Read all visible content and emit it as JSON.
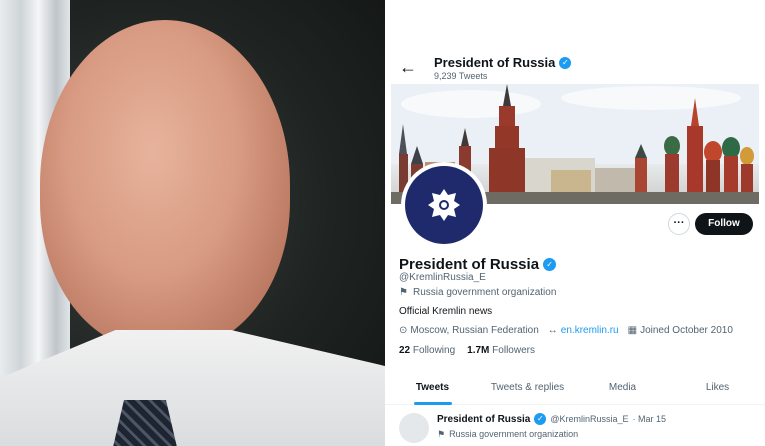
{
  "header": {
    "title": "President of Russia",
    "tweet_count": "9,239 Tweets"
  },
  "profile": {
    "name": "President of Russia",
    "handle": "@KremlinRussia_E",
    "category": "Russia government organization",
    "bio": "Official Kremlin news",
    "location": "Moscow, Russian Federation",
    "website": "en.kremlin.ru",
    "joined": "Joined October 2010",
    "following_count": "22",
    "following_label": "Following",
    "followers_count": "1.7M",
    "followers_label": "Followers"
  },
  "actions": {
    "more": "···",
    "follow": "Follow"
  },
  "tabs": [
    {
      "label": "Tweets",
      "active": true
    },
    {
      "label": "Tweets & replies",
      "active": false
    },
    {
      "label": "Media",
      "active": false
    },
    {
      "label": "Likes",
      "active": false
    }
  ],
  "tweet": {
    "name": "President of Russia",
    "handle": "@KremlinRussia_E",
    "date": "· Mar 15",
    "category": "Russia government organization"
  },
  "icons": {
    "back": "←",
    "verified": "✓",
    "flag": "⚑",
    "location": "⊙",
    "link": "↔",
    "calendar": "▦"
  },
  "colors": {
    "accent": "#1d9bf0",
    "text": "#0f1419",
    "muted": "#536471"
  }
}
